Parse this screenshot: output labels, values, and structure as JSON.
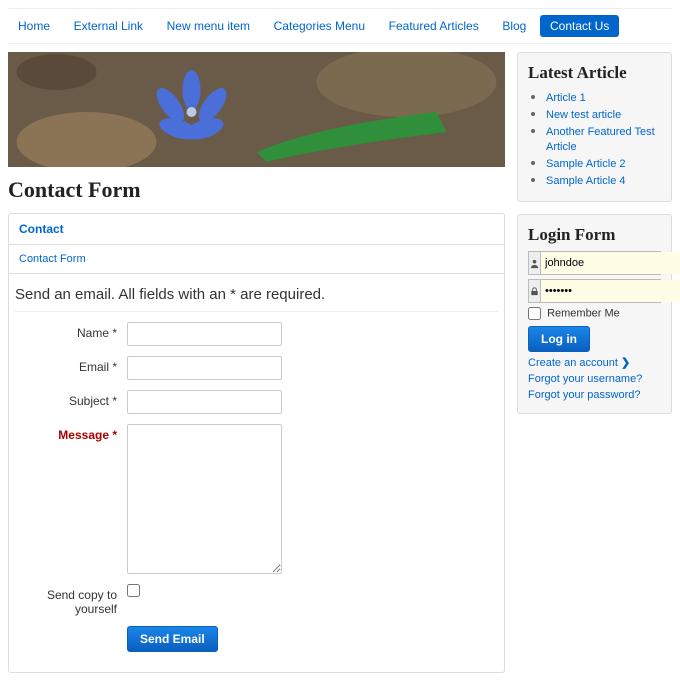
{
  "nav": {
    "items": [
      {
        "label": "Home"
      },
      {
        "label": "External Link"
      },
      {
        "label": "New menu item"
      },
      {
        "label": "Categories Menu"
      },
      {
        "label": "Featured Articles"
      },
      {
        "label": "Blog"
      },
      {
        "label": "Contact Us",
        "active": true
      }
    ]
  },
  "page": {
    "title": "Contact Form"
  },
  "tabs": {
    "primary": "Contact",
    "secondary": "Contact Form"
  },
  "form": {
    "legend": "Send an email. All fields with an * are required.",
    "name_label": "Name *",
    "email_label": "Email *",
    "subject_label": "Subject *",
    "message_label": "Message *",
    "copy_label": "Send copy to yourself",
    "submit_label": "Send Email",
    "values": {
      "name": "",
      "email": "",
      "subject": "",
      "message": ""
    }
  },
  "latest": {
    "heading": "Latest Article",
    "articles": [
      "Article 1",
      "New test article",
      "Another Featured Test Article",
      "Sample Article 2",
      "Sample Article 4"
    ]
  },
  "login": {
    "heading": "Login Form",
    "username_value": "johndoe",
    "password_value": "•••••••",
    "remember_label": "Remember Me",
    "login_label": "Log in",
    "create_label": "Create an account",
    "forgot_user_label": "Forgot your username?",
    "forgot_pass_label": "Forgot your password?"
  }
}
